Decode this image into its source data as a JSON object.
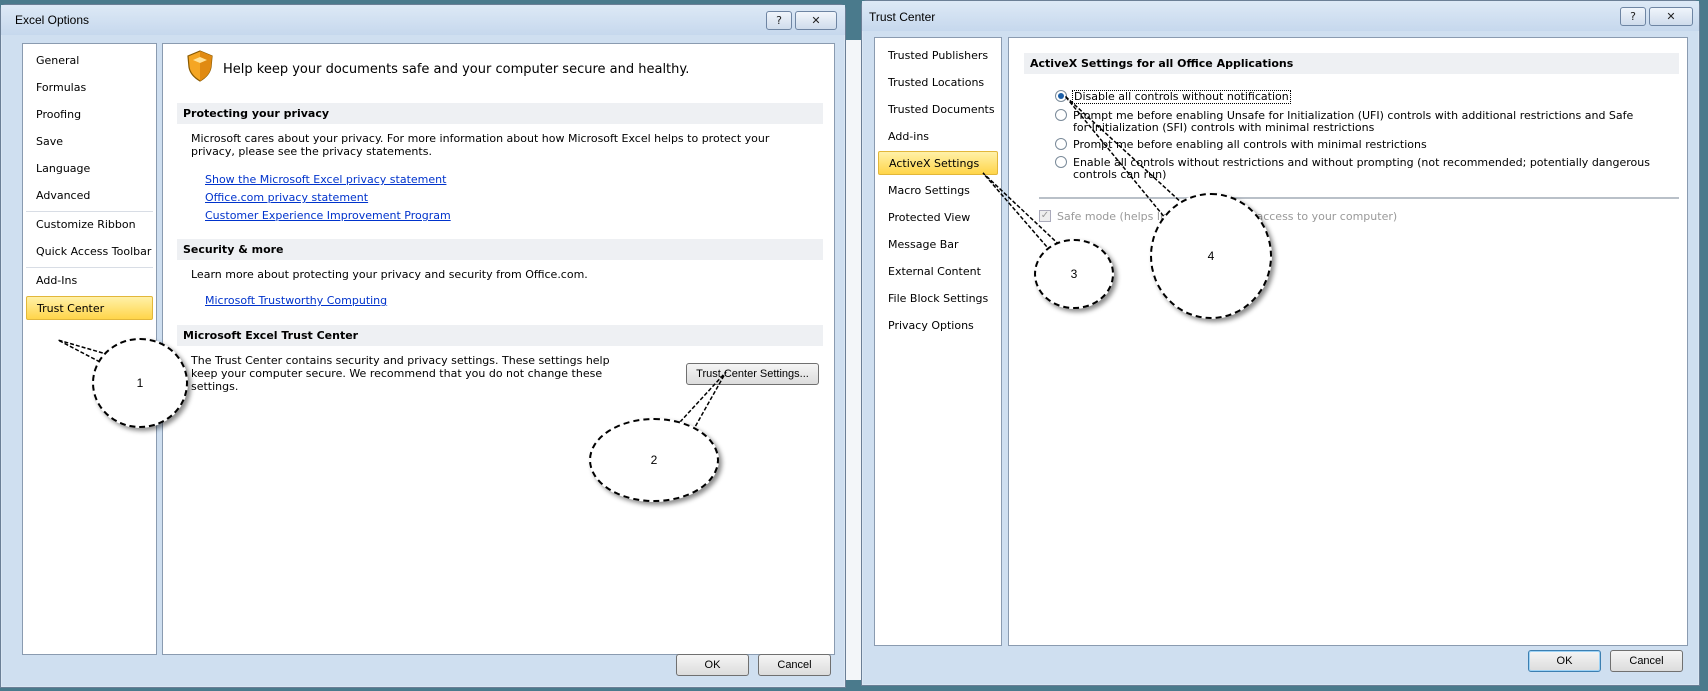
{
  "excel_options": {
    "title": "Excel Options",
    "help": "?",
    "close": "✕",
    "nav": [
      {
        "label": "General"
      },
      {
        "label": "Formulas"
      },
      {
        "label": "Proofing"
      },
      {
        "label": "Save"
      },
      {
        "label": "Language"
      },
      {
        "label": "Advanced"
      },
      {
        "label": "Customize Ribbon"
      },
      {
        "label": "Quick Access Toolbar"
      },
      {
        "label": "Add-Ins"
      },
      {
        "label": "Trust Center",
        "selected": true
      }
    ],
    "intro": "Help keep your documents safe and your computer secure and healthy.",
    "privacy": {
      "heading": "Protecting your privacy",
      "text": "Microsoft cares about your privacy. For more information about how Microsoft Excel helps to protect your privacy, please see the privacy statements.",
      "links": [
        "Show the Microsoft Excel privacy statement",
        "Office.com privacy statement",
        "Customer Experience Improvement Program"
      ]
    },
    "security": {
      "heading": "Security & more",
      "text": "Learn more about protecting your privacy and security from Office.com.",
      "link": "Microsoft Trustworthy Computing"
    },
    "trust": {
      "heading": "Microsoft Excel Trust Center",
      "text": "The Trust Center contains security and privacy settings. These settings help keep your computer secure. We recommend that you do not change these settings.",
      "button": "Trust Center Settings..."
    },
    "ok": "OK",
    "cancel": "Cancel"
  },
  "trust_center": {
    "title": "Trust Center",
    "help": "?",
    "close": "✕",
    "nav": [
      {
        "label": "Trusted Publishers"
      },
      {
        "label": "Trusted Locations"
      },
      {
        "label": "Trusted Documents"
      },
      {
        "label": "Add-ins"
      },
      {
        "label": "ActiveX Settings",
        "selected": true
      },
      {
        "label": "Macro Settings"
      },
      {
        "label": "Protected View"
      },
      {
        "label": "Message Bar"
      },
      {
        "label": "External Content"
      },
      {
        "label": "File Block Settings"
      },
      {
        "label": "Privacy Options"
      }
    ],
    "section_heading": "ActiveX Settings for all Office Applications",
    "options": [
      {
        "label": "Disable all controls without notification",
        "checked": true
      },
      {
        "label": "Prompt me before enabling Unsafe for Initialization (UFI) controls with additional restrictions and Safe for Initialization (SFI) controls with minimal restrictions",
        "checked": false
      },
      {
        "label": "Prompt me before enabling all controls with minimal restrictions",
        "checked": false
      },
      {
        "label": "Enable all controls without restrictions and without prompting (not recommended; potentially dangerous controls can run)",
        "checked": false
      }
    ],
    "safe_mode": "Safe mode (helps limit the control's access to your computer)",
    "ok": "OK",
    "cancel": "Cancel"
  },
  "callouts": [
    "1",
    "2",
    "3",
    "4"
  ],
  "colors": {
    "selected": "#ffd54a",
    "link": "#0033cc",
    "frame": "#cfdff0"
  }
}
